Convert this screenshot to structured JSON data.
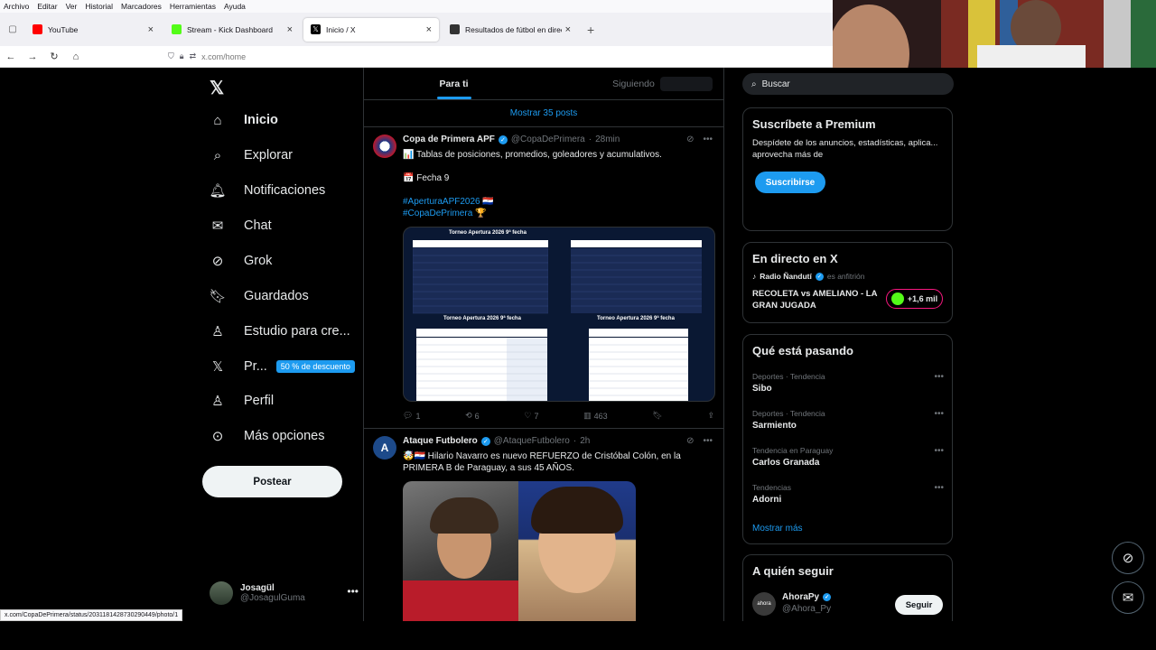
{
  "browser": {
    "menu": [
      "Archivo",
      "Editar",
      "Ver",
      "Historial",
      "Marcadores",
      "Herramientas",
      "Ayuda"
    ],
    "tabs": [
      {
        "label": "YouTube",
        "color": "#ff0000"
      },
      {
        "label": "Stream - Kick Dashboard",
        "color": "#53fc18"
      },
      {
        "label": "Inicio / X",
        "color": "#000000"
      },
      {
        "label": "Resultados de fútbol en directo",
        "color": "#333333"
      }
    ],
    "url": "x.com/home",
    "status_url": "x.com/CopaDePrimera/status/2031181428730290449/photo/1"
  },
  "sidebar": {
    "items": [
      {
        "label": "Inicio",
        "icon": "home-icon"
      },
      {
        "label": "Explorar",
        "icon": "search-icon"
      },
      {
        "label": "Notificaciones",
        "icon": "bell-icon"
      },
      {
        "label": "Chat",
        "icon": "mail-icon"
      },
      {
        "label": "Grok",
        "icon": "grok-icon"
      },
      {
        "label": "Guardados",
        "icon": "bookmark-icon"
      },
      {
        "label": "Estudio para cre...",
        "icon": "creator-studio-icon"
      },
      {
        "label": "Pr...",
        "icon": "x-premium-icon"
      },
      {
        "label": "Perfil",
        "icon": "person-icon"
      },
      {
        "label": "Más opciones",
        "icon": "more-circle-icon"
      }
    ],
    "premium_badge": "50 % de descuento",
    "post_button": "Postear",
    "user": {
      "name": "Josagül",
      "handle": "@JosagulGuma"
    }
  },
  "timeline": {
    "tabs": [
      "Para ti",
      "Siguiendo"
    ],
    "show_posts": "Mostrar 35 posts",
    "tweets": [
      {
        "name": "Copa de Primera APF",
        "handle": "@CopaDePrimera",
        "time": "28min",
        "line1": "📊 Tablas de posiciones, promedios, goleadores y acumulativos.",
        "line2": "📅 Fecha 9",
        "hashtag1": "#AperturaAPF2026 🇵🇾",
        "hashtag2": "#CopaDePrimera 🏆",
        "replies": "1",
        "reposts": "6",
        "likes": "7",
        "views": "463",
        "image_titles": [
          "Torneo Apertura 2026 9ª fecha",
          "Torneo Apertura 2026 9ª fecha",
          "Torneo Apertura 2026 9ª fecha"
        ]
      },
      {
        "name": "Ataque Futbolero",
        "handle": "@AtaqueFutbolero",
        "time": "2h",
        "text": "🤯🇵🇾 Hilario Navarro es nuevo REFUERZO de Cristóbal Colón, en la PRIMERA B de Paraguay, a sus 45 AÑOS."
      }
    ]
  },
  "right": {
    "search_placeholder": "Buscar",
    "premium": {
      "title": "Suscríbete a Premium",
      "text": "Despídete de los anuncios, estadísticas, aplica... aprovecha más de",
      "button": "Suscribirse"
    },
    "live": {
      "title": "En directo en X",
      "host": "Radio Ñandutí",
      "host_role": "es anfitrión",
      "show": "RECOLETA vs AMELIANO - LA GRAN JUGADA",
      "listeners": "+1,6 mil"
    },
    "trends": {
      "title": "Qué está pasando",
      "items": [
        {
          "category": "Deportes · Tendencia",
          "name": "Sibo"
        },
        {
          "category": "Deportes · Tendencia",
          "name": "Sarmiento"
        },
        {
          "category": "Tendencia en Paraguay",
          "name": "Carlos Granada"
        },
        {
          "category": "Tendencias",
          "name": "Adorni"
        }
      ],
      "show_more": "Mostrar más"
    },
    "who_to_follow": {
      "title": "A quién seguir",
      "name": "AhoraPy",
      "handle": "@Ahora_Py",
      "button": "Seguir"
    }
  },
  "colors": {
    "accent": "#1d9bf0",
    "bg": "#000000",
    "border": "#2f3336"
  }
}
